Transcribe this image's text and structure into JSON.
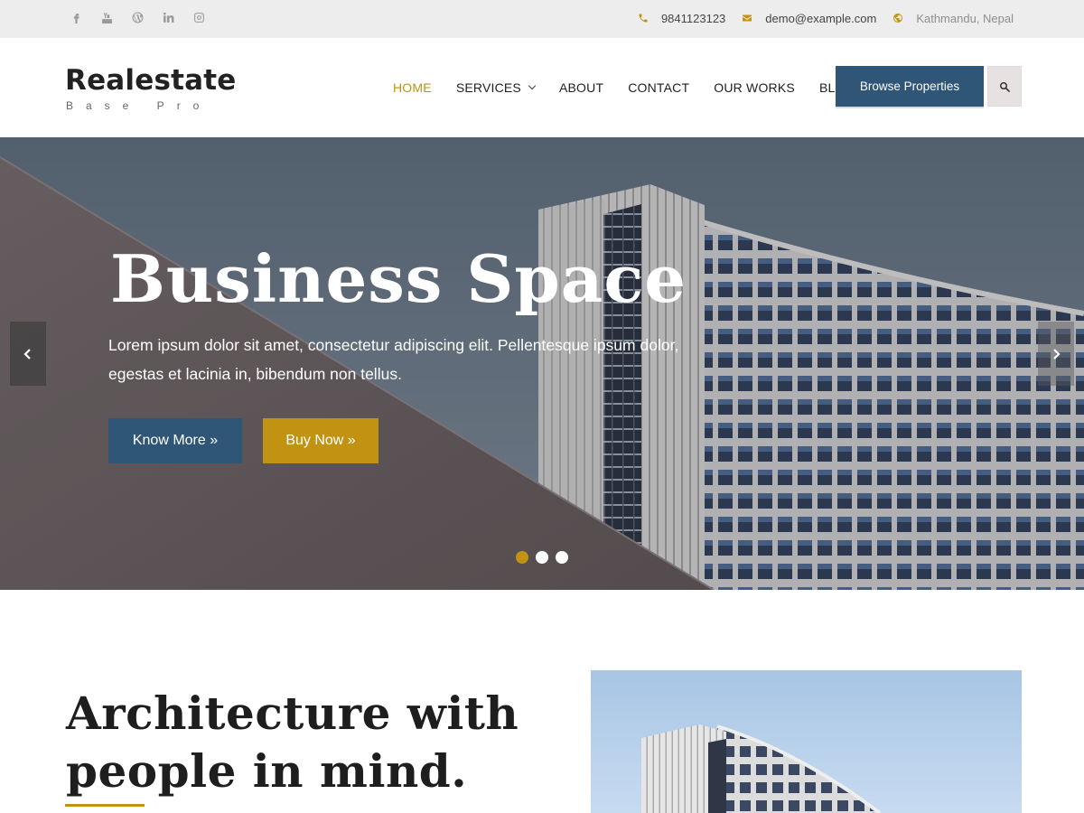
{
  "topbar": {
    "social": [
      {
        "icon": "facebook-icon"
      },
      {
        "icon": "youtube-icon"
      },
      {
        "icon": "wordpress-icon"
      },
      {
        "icon": "linkedin-icon"
      },
      {
        "icon": "instagram-icon"
      }
    ],
    "phone": "9841123123",
    "email": "demo@example.com",
    "location": "Kathmandu, Nepal"
  },
  "header": {
    "logo_name": "Realestate",
    "logo_tagline": "Base Pro",
    "nav": [
      {
        "label": "HOME",
        "active": true
      },
      {
        "label": "SERVICES",
        "has_dropdown": true
      },
      {
        "label": "ABOUT"
      },
      {
        "label": "CONTACT"
      },
      {
        "label": "OUR WORKS"
      },
      {
        "label": "BLOG"
      }
    ],
    "cta_label": "Browse Properties",
    "search_icon": "search-icon"
  },
  "hero": {
    "title": "Business Space",
    "text": "Lorem ipsum dolor sit amet, consectetur adipiscing elit. Pellentesque ipsum dolor, egestas et lacinia in, bibendum non tellus.",
    "btn_primary": "Know More »",
    "btn_secondary": "Buy Now »",
    "slides_total": 3,
    "active_slide": 1
  },
  "about": {
    "title": "Architecture with people in mind."
  },
  "colors": {
    "accent_gold": "#c29312",
    "primary_blue": "#2f5577",
    "topbar_bg": "#ededed"
  }
}
